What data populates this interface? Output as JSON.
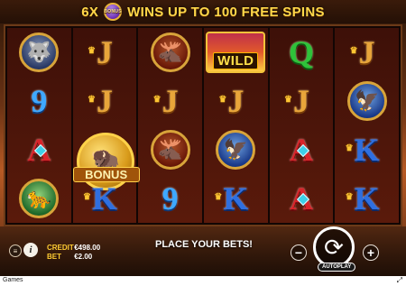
{
  "banner": {
    "multiplier": "6X",
    "text": "WINS UP TO 100 FREE SPINS",
    "coin_label": "BONUS"
  },
  "reels": [
    [
      {
        "kind": "medallion",
        "animal": "wolf",
        "icon": "wolf-icon",
        "glyph": "🐺"
      },
      {
        "kind": "card",
        "rank": "9"
      },
      {
        "kind": "card",
        "rank": "A"
      },
      {
        "kind": "medallion",
        "animal": "puma",
        "icon": "puma-icon",
        "glyph": "🐆"
      }
    ],
    [
      {
        "kind": "card",
        "rank": "J"
      },
      {
        "kind": "card",
        "rank": "J"
      },
      {
        "kind": "bonus"
      },
      {
        "kind": "card",
        "rank": "K"
      }
    ],
    [
      {
        "kind": "medallion",
        "animal": "moose",
        "icon": "moose-icon",
        "glyph": "🫎"
      },
      {
        "kind": "card",
        "rank": "J"
      },
      {
        "kind": "medallion",
        "animal": "moose",
        "icon": "moose-icon",
        "glyph": "🫎"
      },
      {
        "kind": "card",
        "rank": "9"
      }
    ],
    [
      {
        "kind": "wild"
      },
      {
        "kind": "card",
        "rank": "J"
      },
      {
        "kind": "medallion",
        "animal": "eagle",
        "icon": "eagle-icon",
        "glyph": "🦅"
      },
      {
        "kind": "card",
        "rank": "K"
      }
    ],
    [
      {
        "kind": "card",
        "rank": "Q"
      },
      {
        "kind": "card",
        "rank": "J"
      },
      {
        "kind": "card",
        "rank": "A"
      },
      {
        "kind": "card",
        "rank": "A"
      }
    ],
    [
      {
        "kind": "card",
        "rank": "J"
      },
      {
        "kind": "medallion",
        "animal": "eagle",
        "icon": "eagle-icon",
        "glyph": "🦅"
      },
      {
        "kind": "card",
        "rank": "K"
      },
      {
        "kind": "card",
        "rank": "K"
      }
    ]
  ],
  "symbols": {
    "wild_label": "WILD",
    "bonus_label": "BONUS",
    "bonus_glyph": "🦬"
  },
  "footer": {
    "credit_label": "CREDIT",
    "credit_value": "€498.00",
    "bet_label": "BET",
    "bet_value": "€2.00",
    "message": "PLACE YOUR BETS!",
    "minus_label": "−",
    "plus_label": "+",
    "autoplay_label": "AUTOPLAY",
    "spin_glyph": "⟳",
    "info_glyph": "i",
    "menu_glyph": "≡"
  },
  "status_bar": {
    "label": "Games",
    "expand_glyph": "⤢"
  },
  "colors": {
    "gold": "#ffcc33",
    "banner_text": "#ffd84a",
    "reel_bg": "#3d1008"
  }
}
